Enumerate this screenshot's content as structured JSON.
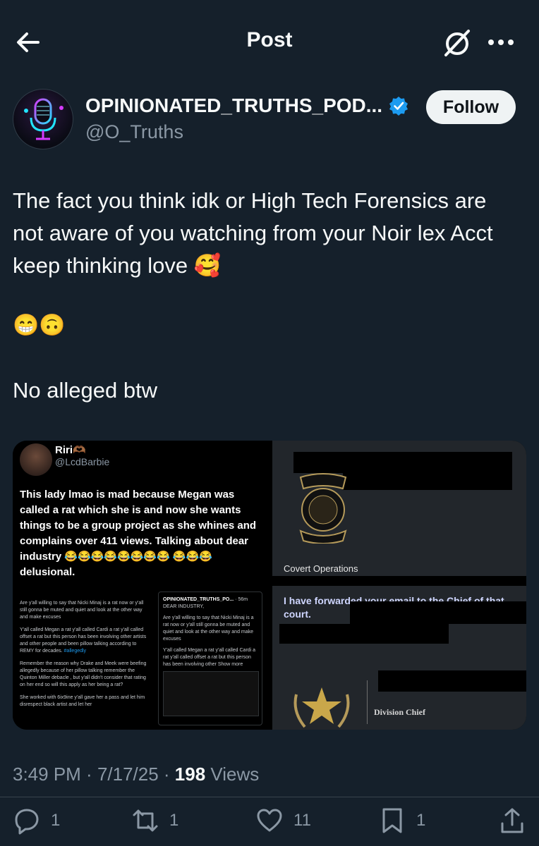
{
  "header": {
    "title": "Post"
  },
  "author": {
    "name": "OPINIONATED_TRUTHS_POD...",
    "handle": "@O_Truths",
    "follow_label": "Follow"
  },
  "post": {
    "text": "The fact you think idk or High Tech Forensics are not aware of you  watching  from your Noir lex Acct keep thinking love 🥰",
    "emojis": "😁🙃",
    "text2": "No alleged btw"
  },
  "media": {
    "left": {
      "name": "Riri🫶🏾",
      "handle": "@LcdBarbie",
      "text": "This lady lmao is mad because Megan was called a rat which she is and now she wants things to be a group project as she whines and complains over 411 views. Talking about dear industry 😂😂😂😂😂😂😂😂 😂😂😂 delusional.",
      "quote_col1": "Are y'all willing to say that Nicki Minaj is a rat now or y'all still gonna be muted and quiet and look at the other way and make excuses",
      "quote_col1b": "Y'all called Megan a rat y'all called Cardi a rat y'all called offset a  rat but this person has been involving other artists and other people  and been pillow talking according to REMY for decades.",
      "quote_hashtag": "#allegedly",
      "quote_col1c": "Remember the reason why Drake and Meek were beefing allegedly because of her pillow talking remember the Quinton Miller debacle , but y'all didn't consider that rating on her end so will this apply as her being a rat?",
      "quote_col1d": "She worked with 6ix9ine y'all gave her a pass and let him disrespect black artist and let her",
      "inner_name": "OPINIONATED_TRUTHS_PO...",
      "inner_time": "· 56m",
      "inner_title": "DEAR INDUSTRY,",
      "inner_p1": "Are y'all willing to say that Nicki Minaj is a rat now or y'all still gonna be muted and quiet and look at the other way and make excuses",
      "inner_p2": "Y'all called Megan a rat y'all called Cardi a rat y'all called offset a  rat but this person has been involving other Show more"
    },
    "right": {
      "covert": "Covert Operations",
      "forward_text": "I have forwarded your email to the Chief of that court.",
      "division_chief": "Division Chief"
    }
  },
  "meta": {
    "time": "3:49 PM",
    "sep1": " · ",
    "date": "7/17/25",
    "sep2": " · ",
    "views": "198",
    "views_label": " Views"
  },
  "actions": {
    "replies": "1",
    "reposts": "1",
    "likes": "11",
    "bookmarks": "1"
  },
  "colors": {
    "background": "#15202b",
    "accent": "#1d9bf0",
    "muted": "#8b98a5"
  }
}
